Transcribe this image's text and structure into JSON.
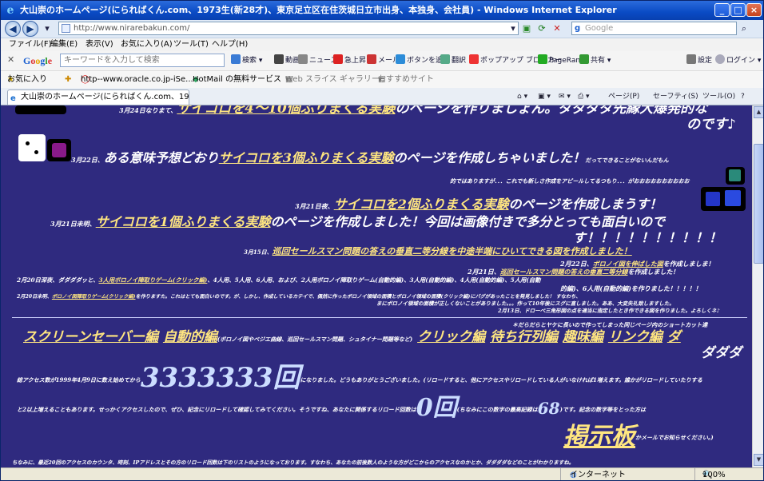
{
  "window": {
    "title": "大山崇のホームページ(にらればくん.com、1973生(新28才)、東京足立区在住茨城日立市出身、本独身、会社員) - Windows Internet Explorer",
    "minimize": "_",
    "maximize": "□",
    "close": "×"
  },
  "address": {
    "url": "http://www.nirarebakun.com/",
    "search_placeholder": "Google"
  },
  "menu": [
    "ファイル(F)",
    "編集(E)",
    "表示(V)",
    "お気に入り(A)",
    "ツール(T)",
    "ヘルプ(H)"
  ],
  "google_toolbar": {
    "logo": "Google",
    "placeholder": "キーワードを入力して検索",
    "search_label": "検索",
    "buttons": [
      "動画",
      "ニュース",
      "急上昇",
      "メール",
      "ボタンを追加",
      "翻訳",
      "ポップアップ ブロッカー",
      "PageRank",
      "共有",
      "設定",
      "ログイン"
    ]
  },
  "favorites": {
    "label": "お気に入り",
    "items": [
      "http--www.oracle.co.jp-iSe...",
      "HotMail の無料サービス",
      "Web スライス ギャラリー",
      "おすすめサイト"
    ]
  },
  "tab": {
    "title": "大山崇のホームページ(にらればくん.com、1973生(新28..."
  },
  "command_bar": [
    "ページ(P)",
    "セーフティ(S)",
    "ツール(O)"
  ],
  "content": {
    "l1_date": "3月24日なりまて、",
    "l1_link": "サイコロを4〜10個ふりまくる実験",
    "l1_rest": "のページを作りましょん。ダダダダ先縁大爆発的な",
    "l1_end": "のです♪",
    "l2_date": "3月22日、",
    "l2_pre": "ある意味予想どおり",
    "l2_link": "サイコロを3個ふりまくる実験",
    "l2_rest": "のページを作成しちゃいました！",
    "l2_small": "だってできることがないんだもん",
    "l3_small": "的ではありますが．．．これでも新しさ作成をアピールしてるつもり．．．がおおおおおおおおおお",
    "l4_date": "3月21日夜、",
    "l4_link": "サイコロを2個ふりまくる実験",
    "l4_rest": "のページを作成しまうす！",
    "l5_date": "3月21日未明、",
    "l5_link": "サイコロを1個ふりまくる実験",
    "l5_rest": "のページを作成しました！今回は画像付きで多分とっても面白いので",
    "l6": "す！！！！！！！！！！",
    "l7_date": "3月15日、",
    "l7_link": "巡回セールスマン問題の答えの垂直二等分線を中途半端にひいてできる図を作成しました！",
    "l8_date": "2月22日、",
    "l8_link": "ボロノイ図を伸ばした図",
    "l8_rest": "を作成しましま！",
    "l9_date": "2月21日、",
    "l9_link": "巡回セールスマン問題の答えの垂直二等分線",
    "l9_rest": "を作成しました！",
    "l10_date": "2月20日深夜、ダダダダッと、",
    "l10_link": "3人用ボロノイ陣取りゲーム(クリック編)",
    "l10_rest": "、4人用、5人用、6人用、および、2人用ボロノイ陣取りゲーム(自動的編)、3人用(自動的編)、4人用(自動的編)、5人用(自動",
    "l11": "的編)、6人用(自動的編)を作りました！！！！！",
    "l12_date": "2月20日未明、",
    "l12_link": "ボロノイ図陣取りゲーム(クリック編)",
    "l12_rest": "を作りますた。これはとても面白いのです。が、しかし、作成しているカテイで、偶然に作ったボロノイ領域の面積とボロノイ領域の面積(クリック編)にバグがあったことを発見しました！ すなわち、",
    "l13": "まにボロノイ領域の面積が正しくないことがありました。。。作って10年後にスグに直しました。ああ、大変失礼致しますした。",
    "l14": "2月13日、ドローベ三角形図の点を適当に指定したとき作できる図を作りました。よろしくネ♪",
    "shortcut_note": "＊だらだらとヤケに長いので作ってしまった同じページ内のショートカット達",
    "cat_links": [
      "スクリーンセーバー編",
      "自動的編",
      "クリック編",
      "待ち行列編",
      "趣味編",
      "リンク編",
      "ダ"
    ],
    "cat_auto_sub": "(ボロノイ図やベジエ曲線、巡回セールスマン問題、シュタイナー問題等など)",
    "cat_end": "ダダダ",
    "access_pre": "総アクセス数が1999年4月9日に数え始めてから",
    "access_count": "3333333回",
    "access_post": "になりました。どうもありがとうございました。(リロードすると、他にアクセスやリロードしている人がいなければ1増えます。誰かがリロードしていたりする",
    "reload_pre": "と2以上増えることもあります。せっかくアクセスしたので、ぜひ、記念にリロードして確認してみてください。そうですね、あなたに関係するリロード回数は",
    "reload_count": "0回",
    "reload_mid": "(ちなみにこの数字の最高記録は",
    "reload_max": "68",
    "reload_post": ")です。記念の数字等をとった方は",
    "board": "掲示板",
    "board_post": "かメールでお知らせください。)",
    "last_line": "ちなみに、最近20回のアクセスのカウンタ、時刻、IPアドレスとその方のリロード回数は下のリストのようになっております。すなわち、あなたの前後数人のような方がどこからのアクセスなのかとか、ダダダダなどのことがわかりますね。"
  },
  "status": {
    "zone": "インターネット",
    "zoom": "100%"
  },
  "colors": {
    "page_bg": "#2f2a7f",
    "link": "#ffe680",
    "title_bar": "#0a4bc4"
  }
}
